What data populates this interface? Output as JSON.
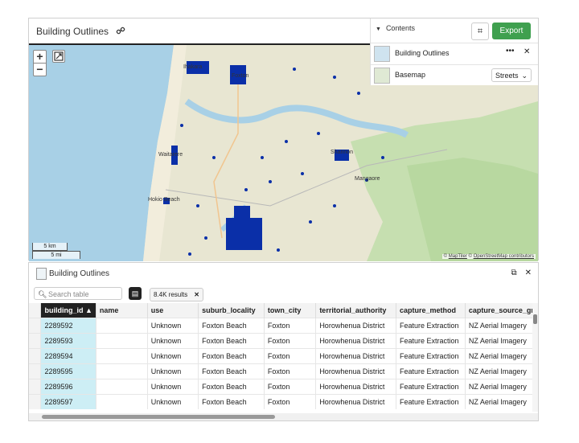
{
  "header": {
    "title": "Building Outlines"
  },
  "panel": {
    "contents_label": "Contents",
    "export_label": "Export",
    "layers": [
      {
        "name": "Building Outlines"
      },
      {
        "name": "Basemap",
        "style": "Streets"
      }
    ]
  },
  "map": {
    "places": [
      "Foxton",
      "Waitarere",
      "Hokio Beach",
      "Shannon",
      "Mangaore",
      "Ihakara"
    ],
    "scale_km": "5 km",
    "scale_mi": "5 mi",
    "attribution_1": "MapTiler",
    "attribution_2": "OpenStreetMap contributors",
    "colors": {
      "land": "#e8e6d2",
      "sea": "#a8d0e6",
      "buildings": "#0a2fa8",
      "forest": "#c6dfb0",
      "arrow": "#2e8b3b"
    }
  },
  "table": {
    "title": "Building Outlines",
    "search_placeholder": "Search table",
    "results": "8.4K results",
    "columns": [
      "building_id",
      "name",
      "use",
      "suburb_locality",
      "town_city",
      "territorial_authority",
      "capture_method",
      "capture_source_gr"
    ],
    "rows": [
      [
        "2289592",
        "",
        "Unknown",
        "Foxton Beach",
        "Foxton",
        "Horowhenua District",
        "Feature Extraction",
        "NZ Aerial Imagery"
      ],
      [
        "2289593",
        "",
        "Unknown",
        "Foxton Beach",
        "Foxton",
        "Horowhenua District",
        "Feature Extraction",
        "NZ Aerial Imagery"
      ],
      [
        "2289594",
        "",
        "Unknown",
        "Foxton Beach",
        "Foxton",
        "Horowhenua District",
        "Feature Extraction",
        "NZ Aerial Imagery"
      ],
      [
        "2289595",
        "",
        "Unknown",
        "Foxton Beach",
        "Foxton",
        "Horowhenua District",
        "Feature Extraction",
        "NZ Aerial Imagery"
      ],
      [
        "2289596",
        "",
        "Unknown",
        "Foxton Beach",
        "Foxton",
        "Horowhenua District",
        "Feature Extraction",
        "NZ Aerial Imagery"
      ],
      [
        "2289597",
        "",
        "Unknown",
        "Foxton Beach",
        "Foxton",
        "Horowhenua District",
        "Feature Extraction",
        "NZ Aerial Imagery"
      ]
    ]
  }
}
